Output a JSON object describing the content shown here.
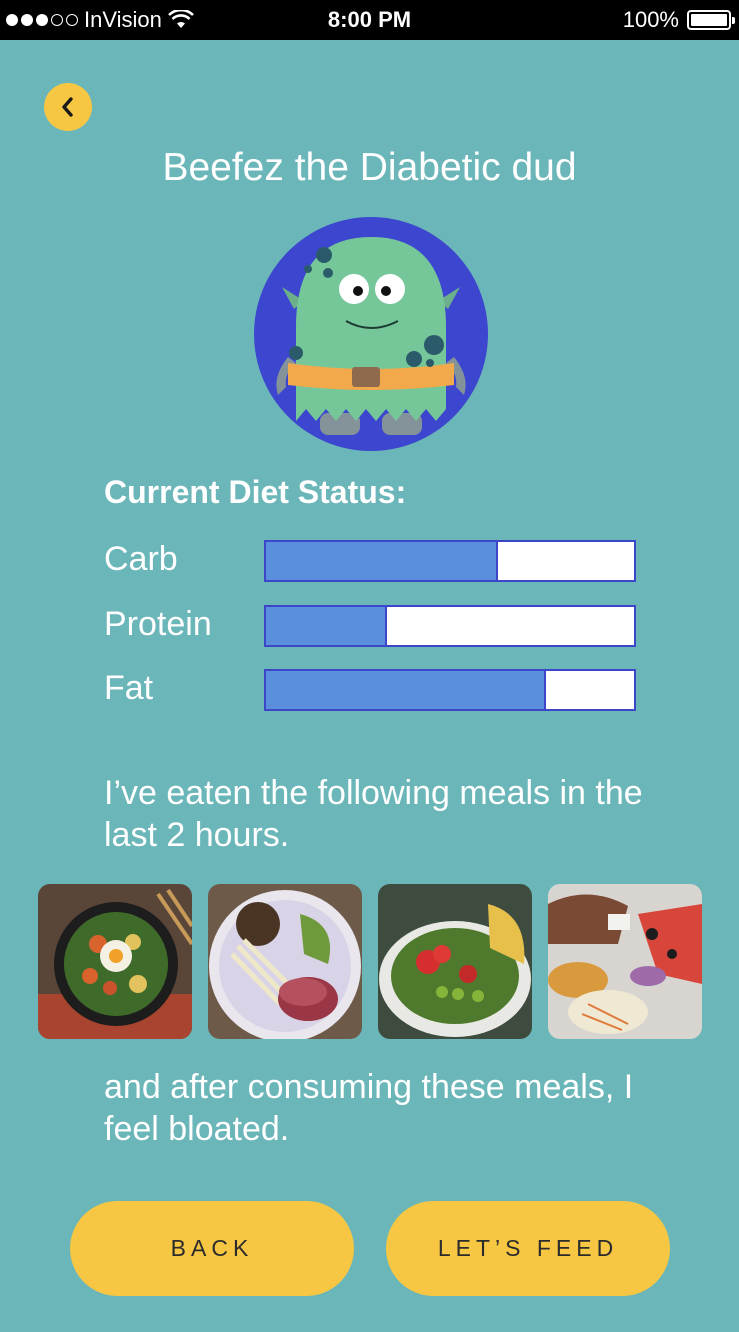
{
  "status_bar": {
    "carrier": "InVision",
    "time": "8:00 PM",
    "battery": "100%"
  },
  "header": {
    "back_icon": "chevron-left-icon",
    "title": "Beefez the Diabetic dud"
  },
  "diet": {
    "heading": "Current Diet Status:",
    "items": [
      {
        "label": "Carb",
        "level": 0.63
      },
      {
        "label": "Protein",
        "level": 0.33
      },
      {
        "label": "Fat",
        "level": 0.76
      }
    ]
  },
  "meals": {
    "intro": "I’ve eaten the following meals in the last 2 hours.",
    "outro": "and after consuming these meals, I feel bloated."
  },
  "buttons": {
    "back": "BACK",
    "feed": "LET’S FEED"
  },
  "colors": {
    "background": "#6bb6b9",
    "accent": "#f7c744",
    "bar_fill": "#5a8fde",
    "bar_border": "#3c46c8"
  }
}
